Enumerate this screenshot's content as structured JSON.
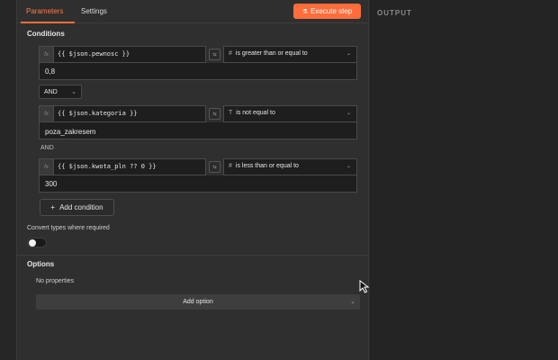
{
  "tabs": [
    {
      "label": "Parameters",
      "active": true
    },
    {
      "label": "Settings",
      "active": false
    }
  ],
  "execute_button": {
    "label": "Execute step",
    "icon": "flask-icon"
  },
  "output": {
    "title": "OUTPUT"
  },
  "conditions": {
    "title": "Conditions",
    "rows": [
      {
        "expression": "{{ $json.pewnosc }}",
        "operator_icon": "#",
        "operator": "is greater than or equal to",
        "value": "0,8"
      },
      {
        "expression": "{{ $json.kategoria }}",
        "operator_icon": "T",
        "operator": "is not equal to",
        "value": "poza_zakresem"
      },
      {
        "expression": "{{ $json.kwota_pln ?? 0 }}",
        "operator_icon": "#",
        "operator": "is less than or equal to",
        "value": "300"
      }
    ],
    "combinator_select": "AND",
    "combinator_text": "AND",
    "add_condition_label": "Add condition"
  },
  "convert_types": {
    "label": "Convert types where required",
    "enabled": false
  },
  "options": {
    "title": "Options",
    "empty_text": "No properties",
    "add_option_label": "Add option"
  },
  "colors": {
    "accent": "#ff6d3b",
    "panel": "#2f2f2f",
    "input_bg": "#1e1e1e"
  }
}
